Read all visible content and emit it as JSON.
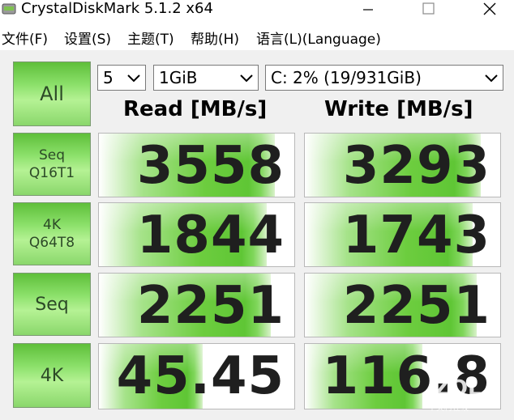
{
  "window": {
    "title": "CrystalDiskMark 5.1.2 x64",
    "minimize_icon": "minimize-icon",
    "maximize_icon": "maximize-icon",
    "close_icon": "close-icon"
  },
  "menu": [
    {
      "label": "文件(F)"
    },
    {
      "label": "设置(S)"
    },
    {
      "label": "主题(T)"
    },
    {
      "label": "帮助(H)"
    },
    {
      "label": "语言(L)(Language)"
    }
  ],
  "controls": {
    "all_label": "All",
    "count": "5",
    "size": "1GiB",
    "drive": "C: 2% (19/931GiB)"
  },
  "headers": {
    "read": "Read [MB/s]",
    "write": "Write [MB/s]"
  },
  "tests": [
    {
      "label_line1": "Seq",
      "label_line2": "Q16T1",
      "read": "3558",
      "write": "3293",
      "read_fill": 0.9,
      "write_fill": 0.9
    },
    {
      "label_line1": "4K",
      "label_line2": "Q64T8",
      "read": "1844",
      "write": "1743",
      "read_fill": 0.86,
      "write_fill": 0.86
    },
    {
      "label_line1": "Seq",
      "label_line2": "",
      "read": "2251",
      "write": "2251",
      "read_fill": 0.88,
      "write_fill": 0.88
    },
    {
      "label_line1": "4K",
      "label_line2": "",
      "read": "45.45",
      "write": "116.8",
      "read_fill": 0.53,
      "write_fill": 0.6
    }
  ],
  "watermark": {
    "main": "ZOL",
    "sub": "中关村在线"
  },
  "colors": {
    "accent_green": "#5fc635",
    "button_green": "#8be06a"
  }
}
